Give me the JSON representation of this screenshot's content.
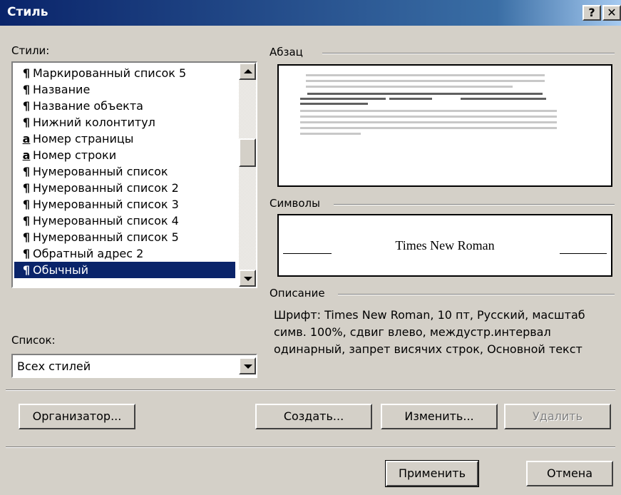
{
  "window": {
    "title": "Стиль",
    "help_label": "?",
    "close_label": "✕"
  },
  "styles_label": "Стили:",
  "styles_list": [
    {
      "glyph": "¶",
      "label": "Маркированный список 5"
    },
    {
      "glyph": "¶",
      "label": "Название"
    },
    {
      "glyph": "¶",
      "label": "Название объекта"
    },
    {
      "glyph": "¶",
      "label": "Нижний колонтитул"
    },
    {
      "glyph": "a",
      "label": "Номер страницы"
    },
    {
      "glyph": "a",
      "label": "Номер строки"
    },
    {
      "glyph": "¶",
      "label": "Нумерованный список"
    },
    {
      "glyph": "¶",
      "label": "Нумерованный список 2"
    },
    {
      "glyph": "¶",
      "label": "Нумерованный список 3"
    },
    {
      "glyph": "¶",
      "label": "Нумерованный список 4"
    },
    {
      "glyph": "¶",
      "label": "Нумерованный список 5"
    },
    {
      "glyph": "¶",
      "label": "Обратный адрес 2"
    },
    {
      "glyph": "¶",
      "label": "Обычный",
      "selected": true
    }
  ],
  "list_label": "Список:",
  "list_select_value": "Всех стилей",
  "paragraph_group": "Абзац",
  "symbols_group": "Символы",
  "symbols_preview": "Times New Roman",
  "description_group": "Описание",
  "description_text": "Шрифт: Times New Roman, 10 пт, Русский, масштаб симв. 100%, сдвиг влево, междустр.интервал одинарный, запрет висячих строк, Основной текст",
  "buttons": {
    "organizer": "Организатор...",
    "create": "Создать...",
    "modify": "Изменить...",
    "delete": "Удалить",
    "apply": "Применить",
    "cancel": "Отмена"
  }
}
